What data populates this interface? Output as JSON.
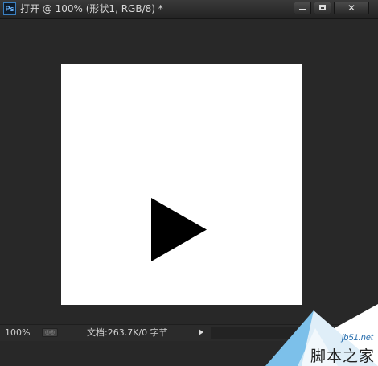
{
  "window": {
    "app_icon_text": "Ps",
    "document_title": "打开 @ 100% (形状1, RGB/8) *",
    "controls": {
      "minimize_icon": "minimize-icon",
      "maximize_icon": "maximize-icon",
      "close_glyph": "✕"
    }
  },
  "canvas": {
    "background": "#ffffff",
    "shape": {
      "type": "play-triangle",
      "color": "#000000"
    }
  },
  "statusbar": {
    "zoom": "100%",
    "doc_info": "文档:263.7K/0 字节",
    "menu_arrow_icon": "play-arrow-icon"
  },
  "watermark": {
    "url": "jb51.net",
    "text": "脚本之家"
  },
  "colors": {
    "workspace": "#282828",
    "titlebar": "#2e2e2e",
    "watermark_blue": "#2a6fae"
  }
}
